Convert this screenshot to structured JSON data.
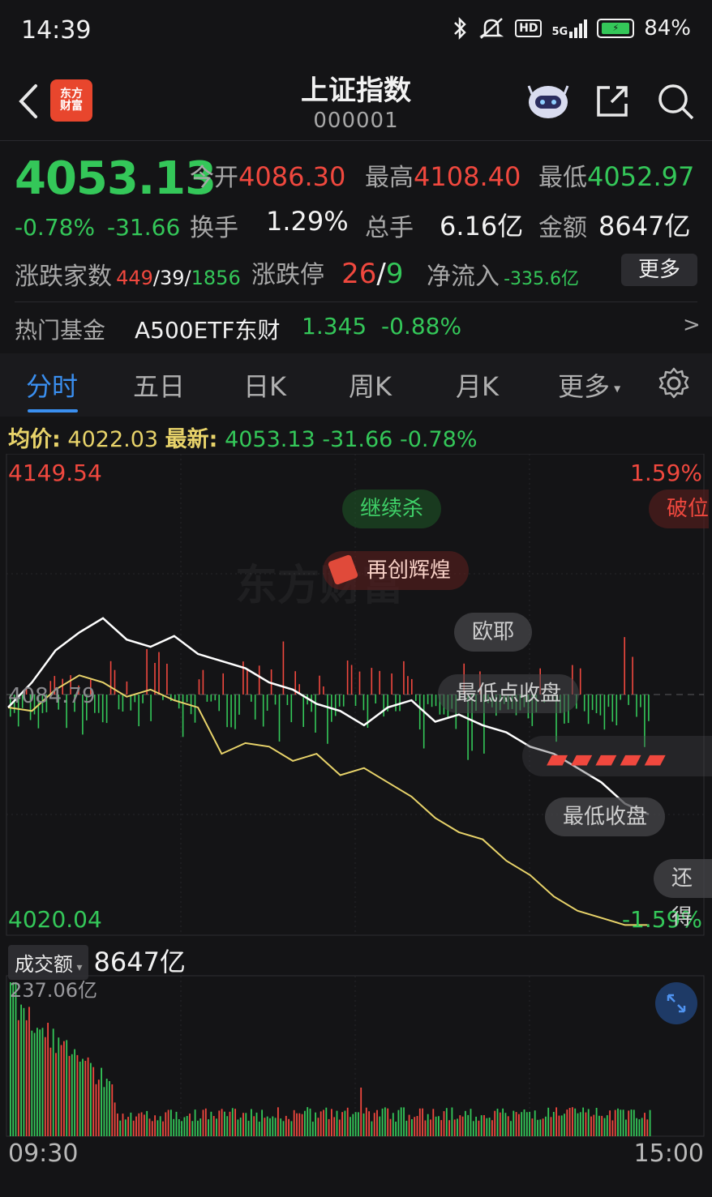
{
  "status": {
    "time": "14:39",
    "signal": "5G",
    "hd": "HD",
    "battery": "84%"
  },
  "header": {
    "title": "上证指数",
    "code": "000001",
    "logo": "东方财富"
  },
  "quote": {
    "price": "4053.13",
    "change_pct": "-0.78%",
    "change_val": "-31.66",
    "open_label": "今开",
    "open": "4086.30",
    "high_label": "最高",
    "high": "4108.40",
    "low_label": "最低",
    "low": "4052.97",
    "turnover_label": "换手",
    "turnover": "1.29%",
    "volume_label": "总手",
    "volume": "6.16亿",
    "amount_label": "金额",
    "amount": "8647亿",
    "breadth_label": "涨跌家数",
    "breadth_up": "449",
    "breadth_sep1": "/",
    "breadth_flat": "39",
    "breadth_sep2": "/",
    "breadth_down": "1856",
    "limit_label": "涨跌停",
    "limit_up": "26",
    "limit_sep": "/",
    "limit_down": "9",
    "netflow_label": "净流入",
    "netflow": "-335.6亿",
    "more_label": "更多"
  },
  "fund": {
    "label": "热门基金",
    "name": "A500ETF东财",
    "price": "1.345",
    "change": "-0.88%",
    "arrow": ">"
  },
  "tabs": [
    {
      "label": "分时",
      "active": true
    },
    {
      "label": "五日"
    },
    {
      "label": "日K"
    },
    {
      "label": "周K"
    },
    {
      "label": "月K"
    },
    {
      "label": "更多"
    }
  ],
  "info": {
    "avg_label": "均价:",
    "avg": "4022.03",
    "latest_label": "最新:",
    "latest": "4053.13",
    "chg": "-31.66",
    "pct": "-0.78%"
  },
  "chart": {
    "top_price": "4149.54",
    "bottom_price": "4020.04",
    "top_pct": "1.59%",
    "bottom_pct": "-1.59%",
    "prev_close": "4084.79",
    "watermark": "东方财富"
  },
  "danmaku": [
    "继续杀",
    "破位",
    "再创辉煌",
    "欧耶",
    "最低点收盘",
    "最低收盘",
    "还得"
  ],
  "volume": {
    "select": "成交额",
    "total": "8647亿",
    "max_label": "237.06亿"
  },
  "time_axis": {
    "start": "09:30",
    "end": "15:00"
  },
  "colors": {
    "up": "#f0483e",
    "down": "#34c759",
    "accent": "#3a8ff0",
    "avg_line": "#e8d36a",
    "price_line": "#ffffff"
  },
  "chart_data": {
    "type": "line",
    "x": [
      "09:30",
      "15:00"
    ],
    "series": [
      {
        "name": "最新",
        "color": "#ffffff",
        "values": [
          4083,
          4090,
          4099,
          4104,
          4108,
          4102,
          4100,
          4103,
          4098,
          4096,
          4094,
          4090,
          4088,
          4084,
          4082,
          4078,
          4083,
          4085,
          4079,
          4081,
          4078,
          4076,
          4072,
          4070,
          4066,
          4062,
          4056,
          4053
        ]
      },
      {
        "name": "均价",
        "color": "#e8d36a",
        "values": [
          4083,
          4082,
          4088,
          4092,
          4090,
          4086,
          4088,
          4085,
          4083,
          4070,
          4073,
          4072,
          4068,
          4070,
          4064,
          4066,
          4062,
          4058,
          4052,
          4048,
          4046,
          4040,
          4036,
          4030,
          4026,
          4024,
          4022,
          4022
        ]
      }
    ],
    "ylim": [
      4020.04,
      4149.54
    ]
  }
}
